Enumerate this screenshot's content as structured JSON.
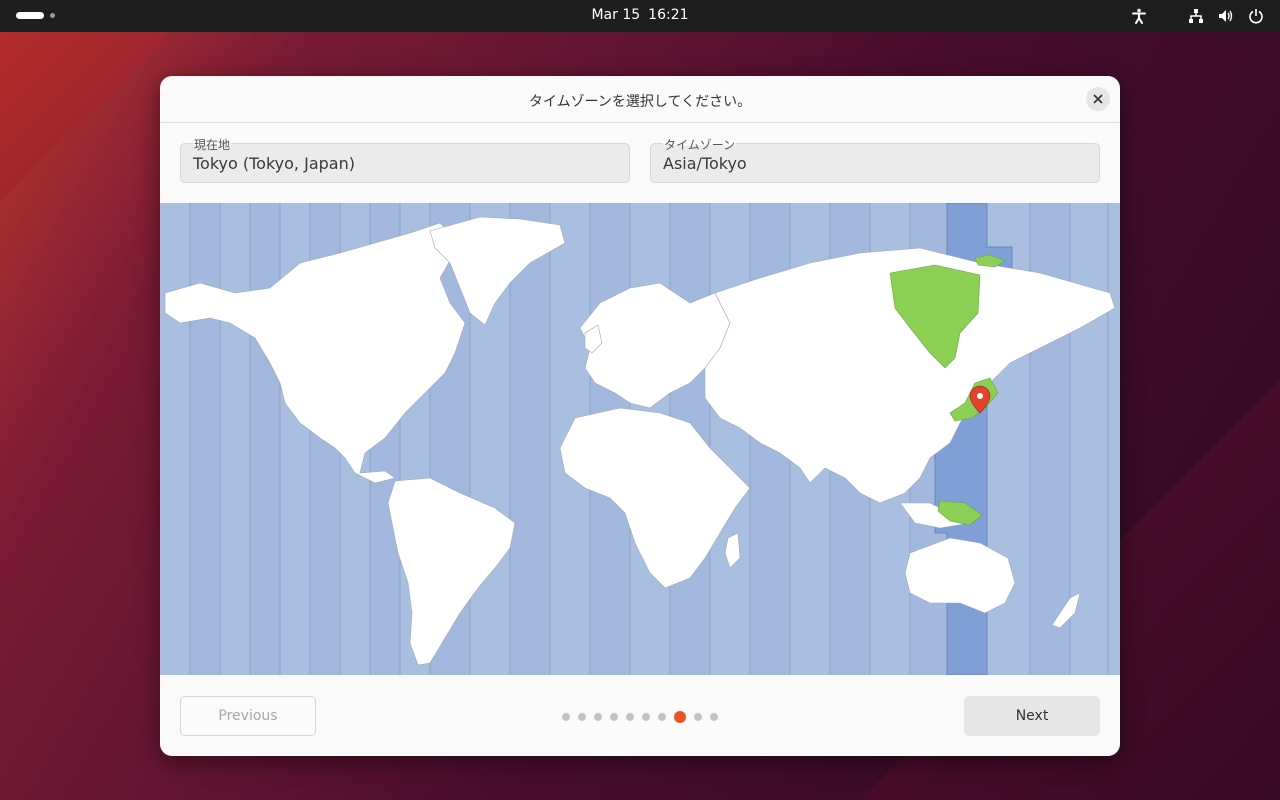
{
  "topbar": {
    "date": "Mar 15",
    "time": "16:21"
  },
  "dialog": {
    "title": "タイムゾーンを選択してください。",
    "location": {
      "label": "現在地",
      "value": "Tokyo (Tokyo, Japan)"
    },
    "timezone": {
      "label": "タイムゾーン",
      "value": "Asia/Tokyo"
    },
    "previous_label": "Previous",
    "next_label": "Next",
    "steps": {
      "total": 10,
      "current": 8
    }
  },
  "colors": {
    "accent": "#e95420",
    "ocean": "#a9bfe0",
    "selected_zone": "#7f9fd6",
    "highlight": "#8bcf55"
  }
}
